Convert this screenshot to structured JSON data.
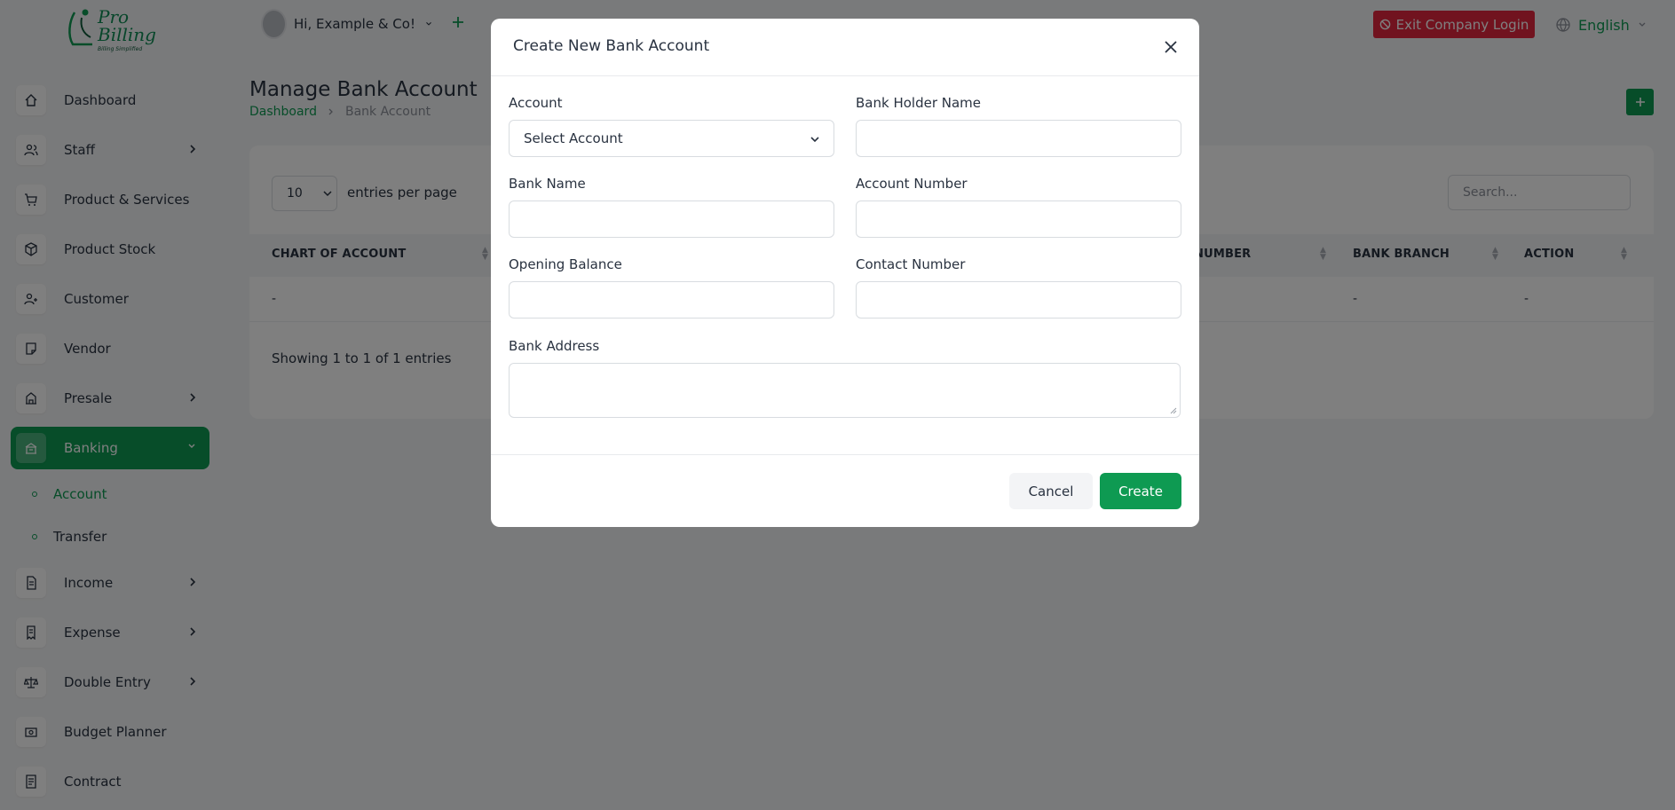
{
  "brand": {
    "name_line1": "Pro",
    "name_line2": "Billing",
    "tagline": "Billing Simplified"
  },
  "header": {
    "greeting": "Hi, Example & Co!",
    "exit_label": "Exit Company Login",
    "language": "English"
  },
  "sidebar": {
    "items": [
      {
        "label": "Dashboard",
        "icon": "home-icon"
      },
      {
        "label": "Staff",
        "icon": "users-icon"
      },
      {
        "label": "Product & Services",
        "icon": "cart-icon"
      },
      {
        "label": "Product Stock",
        "icon": "box-icon"
      },
      {
        "label": "Customer",
        "icon": "user-plus-icon"
      },
      {
        "label": "Vendor",
        "icon": "note-icon"
      },
      {
        "label": "Presale",
        "icon": "building-icon"
      },
      {
        "label": "Banking",
        "icon": "bank-icon"
      },
      {
        "label": "Income",
        "icon": "file-icon"
      },
      {
        "label": "Expense",
        "icon": "receipt-icon"
      },
      {
        "label": "Double Entry",
        "icon": "scale-icon"
      },
      {
        "label": "Budget Planner",
        "icon": "money-icon"
      },
      {
        "label": "Contract",
        "icon": "contract-icon"
      }
    ],
    "banking_sub": [
      {
        "label": "Account"
      },
      {
        "label": "Transfer"
      }
    ]
  },
  "page": {
    "title": "Manage Bank Account",
    "breadcrumb": [
      "Dashboard",
      "Bank Account"
    ],
    "per_page_value": "10",
    "per_page_label": "entries per page",
    "search_placeholder": "Search...",
    "columns": [
      "CHART OF ACCOUNT",
      "NUMBER",
      "BANK BRANCH",
      "ACTION"
    ],
    "row": [
      "-",
      "-",
      "-"
    ],
    "showing": "Showing 1 to 1 of 1 entries"
  },
  "modal": {
    "title": "Create New Bank Account",
    "account_label": "Account",
    "account_value": "Select Account",
    "holder_label": "Bank Holder Name",
    "bank_name_label": "Bank Name",
    "account_number_label": "Account Number",
    "opening_balance_label": "Opening Balance",
    "contact_number_label": "Contact Number",
    "bank_address_label": "Bank Address",
    "cancel_label": "Cancel",
    "create_label": "Create"
  },
  "colors": {
    "accent": "#0e9a52",
    "danger": "#e2263f"
  }
}
